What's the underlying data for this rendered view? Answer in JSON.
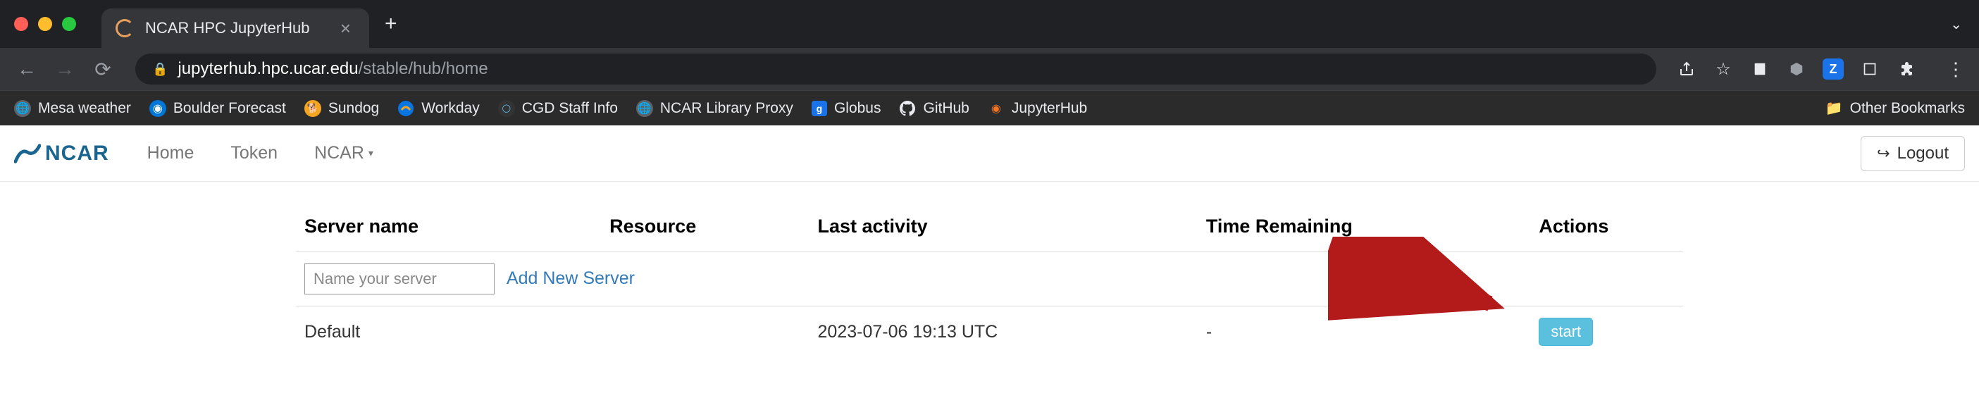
{
  "browser": {
    "tab_title": "NCAR HPC JupyterHub",
    "url_domain": "jupyterhub.hpc.ucar.edu",
    "url_path": "/stable/hub/home"
  },
  "bookmarks": {
    "items": [
      {
        "label": "Mesa weather"
      },
      {
        "label": "Boulder Forecast"
      },
      {
        "label": "Sundog"
      },
      {
        "label": "Workday"
      },
      {
        "label": "CGD Staff Info"
      },
      {
        "label": "NCAR Library Proxy"
      },
      {
        "label": "Globus"
      },
      {
        "label": "GitHub"
      },
      {
        "label": "JupyterHub"
      }
    ],
    "other": "Other Bookmarks"
  },
  "nav": {
    "logo": "NCAR",
    "home": "Home",
    "token": "Token",
    "dropdown": "NCAR",
    "logout": "Logout"
  },
  "table": {
    "headers": {
      "server_name": "Server name",
      "resource": "Resource",
      "last_activity": "Last activity",
      "time_remaining": "Time Remaining",
      "actions": "Actions"
    },
    "new_server": {
      "placeholder": "Name your server",
      "add_link": "Add New Server"
    },
    "rows": [
      {
        "name": "Default",
        "resource": "",
        "last_activity": "2023-07-06 19:13 UTC",
        "time_remaining": "-",
        "action_label": "start"
      }
    ]
  }
}
